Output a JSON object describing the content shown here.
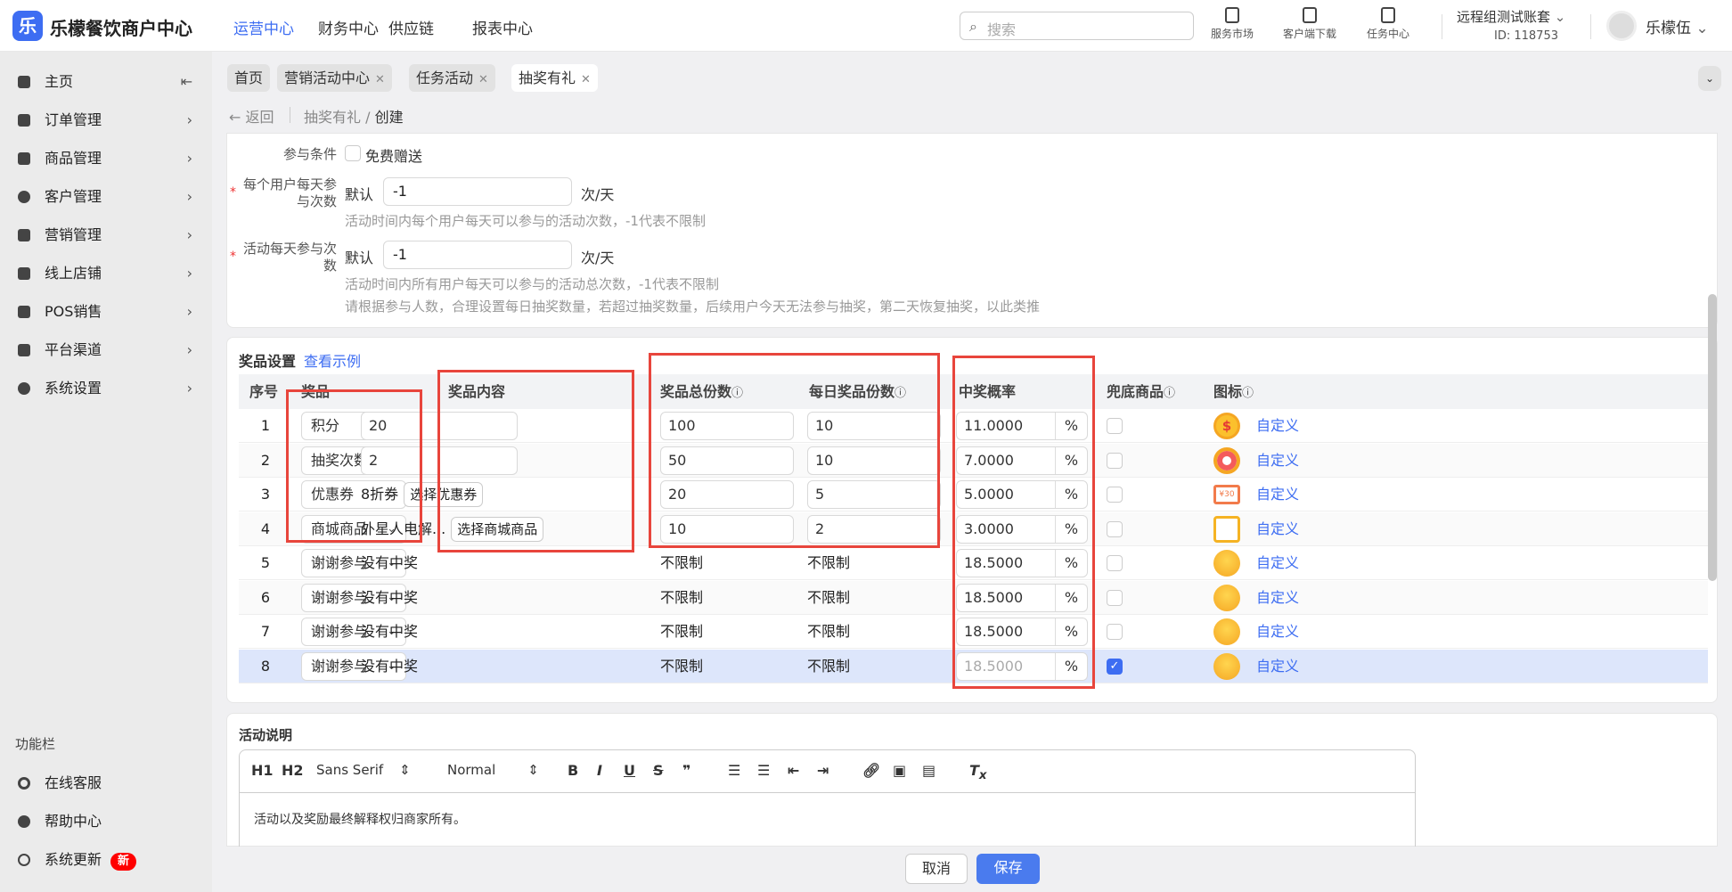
{
  "header": {
    "logo_char": "乐",
    "brand": "乐檬餐饮商户中心",
    "nav": [
      "运营中心",
      "财务中心",
      "供应链",
      "报表中心"
    ],
    "search_placeholder": "搜索",
    "tools": [
      "服务市场",
      "客户端下载",
      "任务中心"
    ],
    "account": "远程组测试账套",
    "account_id": "ID: 118753",
    "user": "乐檬伍"
  },
  "sidebar": {
    "items": [
      "主页",
      "订单管理",
      "商品管理",
      "客户管理",
      "营销管理",
      "线上店铺",
      "POS销售",
      "平台渠道",
      "系统设置"
    ],
    "section": "功能栏",
    "bottom": [
      "在线客服",
      "帮助中心",
      "系统更新"
    ],
    "new_badge": "新"
  },
  "tabs": [
    {
      "label": "首页"
    },
    {
      "label": "营销活动中心"
    },
    {
      "label": "任务活动"
    },
    {
      "label": "抽奖有礼"
    }
  ],
  "breadcrumb": {
    "back": "返回",
    "parent": "抽奖有礼",
    "sep": "/",
    "current": "创建"
  },
  "form": {
    "cond_label": "参与条件",
    "cond_option": "免费赠送",
    "user_daily_label": "每个用户每天参与次数",
    "default": "默认",
    "user_daily_value": "-1",
    "unit": "次/天",
    "user_daily_help": "活动时间内每个用户每天可以参与的活动次数，-1代表不限制",
    "act_daily_label": "活动每天参与次数",
    "act_daily_value": "-1",
    "act_daily_help": "活动时间内所有用户每天可以参与的活动总次数，-1代表不限制",
    "act_daily_note": "请根据参与人数，合理设置每日抽奖数量，若超过抽奖数量，后续用户今天无法参与抽奖，第二天恢复抽奖，以此类推"
  },
  "prizes": {
    "title": "奖品设置",
    "example_link": "查看示例",
    "columns": [
      "序号",
      "奖品",
      "奖品内容",
      "奖品总份数",
      "每日奖品份数",
      "中奖概率",
      "兜底商品",
      "图标"
    ],
    "rows": [
      {
        "no": "1",
        "type": "积分",
        "content": "20",
        "content_btn": "",
        "total": "100",
        "daily": "10",
        "prob": "11.0000",
        "fallback": false,
        "icon": "coin-icon",
        "custom": "自定义"
      },
      {
        "no": "2",
        "type": "抽奖次数",
        "content": "2",
        "content_btn": "",
        "total": "50",
        "daily": "10",
        "prob": "7.0000",
        "fallback": false,
        "icon": "wheel-icon",
        "custom": "自定义"
      },
      {
        "no": "3",
        "type": "优惠券",
        "content": "8折券",
        "content_btn": "选择优惠券",
        "total": "20",
        "daily": "5",
        "prob": "5.0000",
        "fallback": false,
        "icon": "coupon-icon",
        "custom": "自定义"
      },
      {
        "no": "4",
        "type": "商城商品",
        "content": "外星人电解...",
        "content_btn": "选择商城商品",
        "total": "10",
        "daily": "2",
        "prob": "3.0000",
        "fallback": false,
        "icon": "shopping-bag-icon",
        "custom": "自定义"
      },
      {
        "no": "5",
        "type": "谢谢参与",
        "content": "没有中奖",
        "total": "不限制",
        "daily": "不限制",
        "prob": "18.5000",
        "fallback": false,
        "icon": "crying-face-icon",
        "custom": "自定义"
      },
      {
        "no": "6",
        "type": "谢谢参与",
        "content": "没有中奖",
        "total": "不限制",
        "daily": "不限制",
        "prob": "18.5000",
        "fallback": false,
        "icon": "crying-face-icon",
        "custom": "自定义"
      },
      {
        "no": "7",
        "type": "谢谢参与",
        "content": "没有中奖",
        "total": "不限制",
        "daily": "不限制",
        "prob": "18.5000",
        "fallback": false,
        "icon": "crying-face-icon",
        "custom": "自定义"
      },
      {
        "no": "8",
        "type": "谢谢参与",
        "content": "没有中奖",
        "total": "不限制",
        "daily": "不限制",
        "prob": "18.5000",
        "fallback": true,
        "icon": "crying-face-icon",
        "custom": "自定义"
      }
    ],
    "percent": "%"
  },
  "description": {
    "title": "活动说明",
    "toolbar": {
      "h1": "H1",
      "h2": "H2",
      "font": "Sans Serif",
      "size": "Normal"
    },
    "content": "活动以及奖励最终解释权归商家所有。"
  },
  "actions": {
    "cancel": "取消",
    "save": "保存"
  },
  "colors": {
    "accent": "#3d6df2",
    "highlight_box": "#e8453c",
    "selected_row": "#dde6fb"
  }
}
